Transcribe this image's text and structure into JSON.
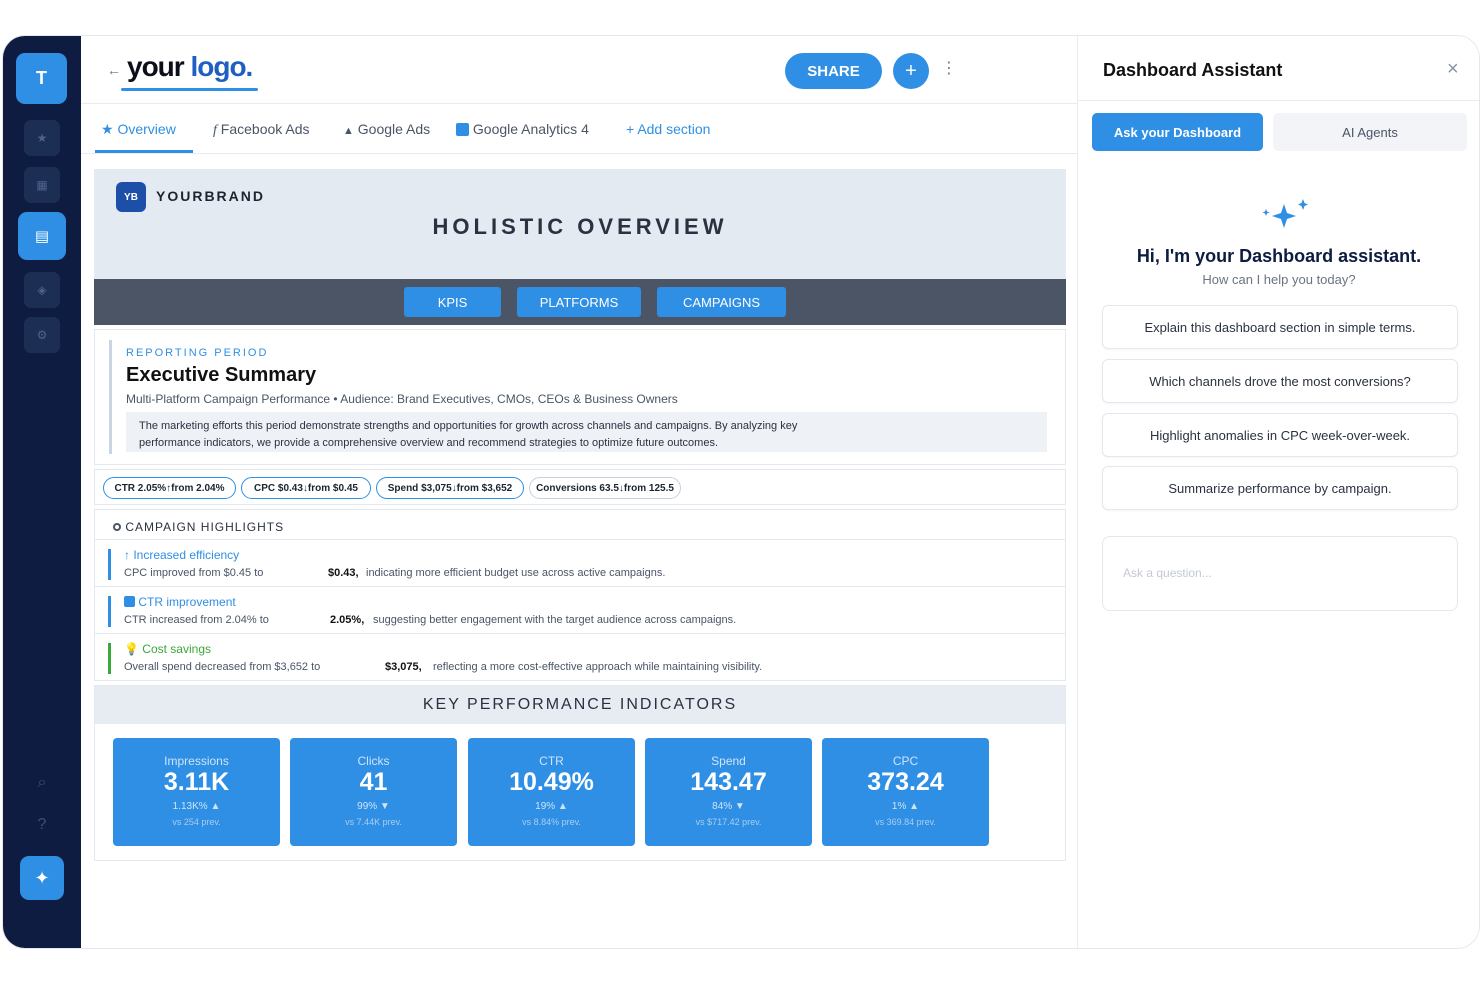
{
  "sidebar": {
    "workspace_initial": "T",
    "icons": [
      "star-icon",
      "grid-icon",
      "list-icon",
      "tag-icon",
      "gear-icon",
      "search-icon",
      "help-icon",
      "sparkle-icon"
    ]
  },
  "header": {
    "back_arrow": "←",
    "logo_part1": "your",
    "logo_part2": "logo.",
    "share_label": "SHARE",
    "add_label": "+",
    "more_label": "⋮"
  },
  "tabs": [
    {
      "label": "Overview",
      "icon": "★"
    },
    {
      "label": "Facebook Ads",
      "icon": "f"
    },
    {
      "label": "Google Ads",
      "icon": "▲"
    },
    {
      "label": "Google Analytics 4",
      "icon": "▪"
    },
    {
      "label": "Add section",
      "icon": "+"
    }
  ],
  "hero": {
    "brand_badge": "YB",
    "brand_name": "YOURBRAND",
    "title": "HOLISTIC OVERVIEW",
    "nav": [
      "KPIS",
      "PLATFORMS",
      "CAMPAIGNS"
    ]
  },
  "executive": {
    "eyebrow": "REPORTING PERIOD",
    "title": "Executive Summary",
    "subtitle": "Multi-Platform Campaign Performance • Audience: Brand Executives, CMOs, CEOs & Business Owners",
    "description_line1": "The marketing efforts this period demonstrate strengths and opportunities for growth across channels and campaigns. By analyzing key",
    "description_line2": "performance indicators, we provide a comprehensive overview and recommend strategies to optimize future outcomes."
  },
  "chips": [
    "CTR 2.05%↑from 2.04%",
    "CPC $0.43↓from $0.45",
    "Spend $3,075↓from $3,652",
    "Conversions 63.5↓from 125.5"
  ],
  "highlights": {
    "title": "CAMPAIGN HIGHLIGHTS",
    "items": [
      {
        "head": "↑ Increased efficiency",
        "a": "CPC improved from $0.45 to",
        "b": "$0.43,",
        "c": "indicating more efficient budget use across active campaigns.",
        "color": "#2e8fe4"
      },
      {
        "head": "CTR improvement",
        "a": "CTR increased from 2.04% to",
        "b": "2.05%,",
        "c": "suggesting better engagement with the target audience across campaigns.",
        "color": "#2e8fe4"
      },
      {
        "head": "Cost savings",
        "a": "Overall spend decreased from $3,652 to",
        "b": "$3,075,",
        "c": "reflecting a more cost-effective approach while maintaining visibility.",
        "color": "#3aa83a"
      }
    ]
  },
  "kpis": {
    "title": "KEY PERFORMANCE INDICATORS",
    "items": [
      {
        "label": "Impressions",
        "value": "3.11K",
        "change": "1.13K% ▲",
        "prev": "vs 254 prev."
      },
      {
        "label": "Clicks",
        "value": "41",
        "change": "99% ▼",
        "prev": "vs 7.44K prev."
      },
      {
        "label": "CTR",
        "value": "10.49%",
        "change": "19% ▲",
        "prev": "vs 8.84% prev."
      },
      {
        "label": "Spend",
        "value": "143.47",
        "change": "84% ▼",
        "prev": "vs $717.42 prev."
      },
      {
        "label": "CPC",
        "value": "373.24",
        "change": "1% ▲",
        "prev": "vs 369.84 prev."
      }
    ]
  },
  "assistant": {
    "title": "Dashboard Assistant",
    "close_label": "×",
    "tab_ask": "Ask your Dashboard",
    "tab_agents": "AI Agents",
    "greeting": "Hi, I'm your Dashboard assistant.",
    "help": "How can I help you today?",
    "suggestions": [
      "Explain this dashboard section in simple terms.",
      "Which channels drove the most conversions?",
      "Highlight anomalies in CPC week-over-week.",
      "Summarize performance by campaign."
    ],
    "input_placeholder": "Ask a question..."
  },
  "colors": {
    "accent": "#2e8fe4",
    "sidebar_bg": "#0d1c40",
    "strip_bg": "#4b5566",
    "positive": "#3aa83a"
  }
}
